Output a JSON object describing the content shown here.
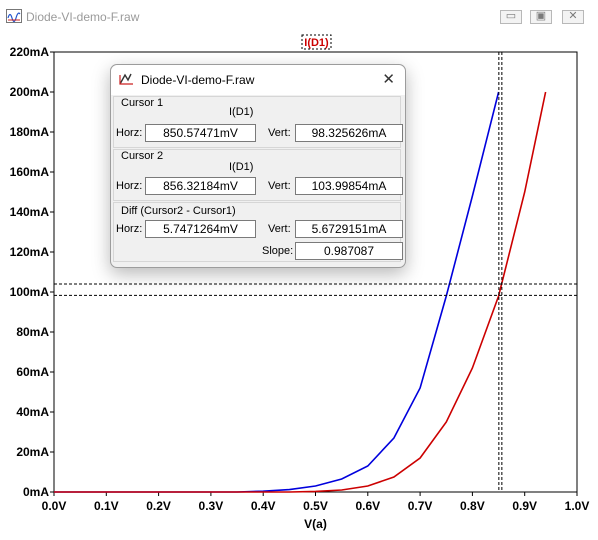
{
  "window": {
    "title": "Diode-VI-demo-F.raw",
    "minimize": "▭",
    "maximize": "▣",
    "close": "✕"
  },
  "chart": {
    "trace_label": "I(D1)",
    "xlabel": "V(a)"
  },
  "chart_data": {
    "type": "line",
    "title": "",
    "xlabel": "V(a)",
    "ylabel": "",
    "xlim": [
      0.0,
      1.0
    ],
    "ylim": [
      0,
      220
    ],
    "x_ticks": [
      "0.0V",
      "0.1V",
      "0.2V",
      "0.3V",
      "0.4V",
      "0.5V",
      "0.6V",
      "0.7V",
      "0.8V",
      "0.9V",
      "1.0V"
    ],
    "y_ticks": [
      "0mA",
      "20mA",
      "40mA",
      "60mA",
      "80mA",
      "100mA",
      "120mA",
      "140mA",
      "160mA",
      "180mA",
      "200mA",
      "220mA"
    ],
    "grid": false,
    "series": [
      {
        "color": "#0000dd",
        "x": [
          0.35,
          0.4,
          0.45,
          0.5,
          0.55,
          0.6,
          0.65,
          0.7,
          0.75,
          0.8,
          0.85
        ],
        "y": [
          0,
          0.4,
          1.2,
          3.0,
          6.5,
          13,
          27,
          52,
          98,
          148,
          200
        ]
      },
      {
        "color": "#cc0000",
        "x": [
          0.45,
          0.5,
          0.55,
          0.6,
          0.65,
          0.7,
          0.75,
          0.8,
          0.85,
          0.9,
          0.94
        ],
        "y": [
          0,
          0.3,
          1.0,
          3.0,
          7.5,
          17,
          35,
          62,
          98,
          150,
          200
        ]
      }
    ],
    "cursors": {
      "v_lines": [
        0.85057,
        0.85632
      ],
      "h_lines": [
        98.33,
        104.0
      ]
    }
  },
  "cursor_dialog": {
    "title": "Diode-VI-demo-F.raw",
    "close": "✕",
    "cursor1": {
      "label": "Cursor 1",
      "trace": "I(D1)",
      "horz_label": "Horz:",
      "horz": "850.57471mV",
      "vert_label": "Vert:",
      "vert": "98.325626mA"
    },
    "cursor2": {
      "label": "Cursor 2",
      "trace": "I(D1)",
      "horz_label": "Horz:",
      "horz": "856.32184mV",
      "vert_label": "Vert:",
      "vert": "103.99854mA"
    },
    "diff": {
      "label": "Diff (Cursor2 - Cursor1)",
      "horz_label": "Horz:",
      "horz": "5.7471264mV",
      "vert_label": "Vert:",
      "vert": "5.6729151mA",
      "slope_label": "Slope:",
      "slope": "0.987087"
    }
  }
}
